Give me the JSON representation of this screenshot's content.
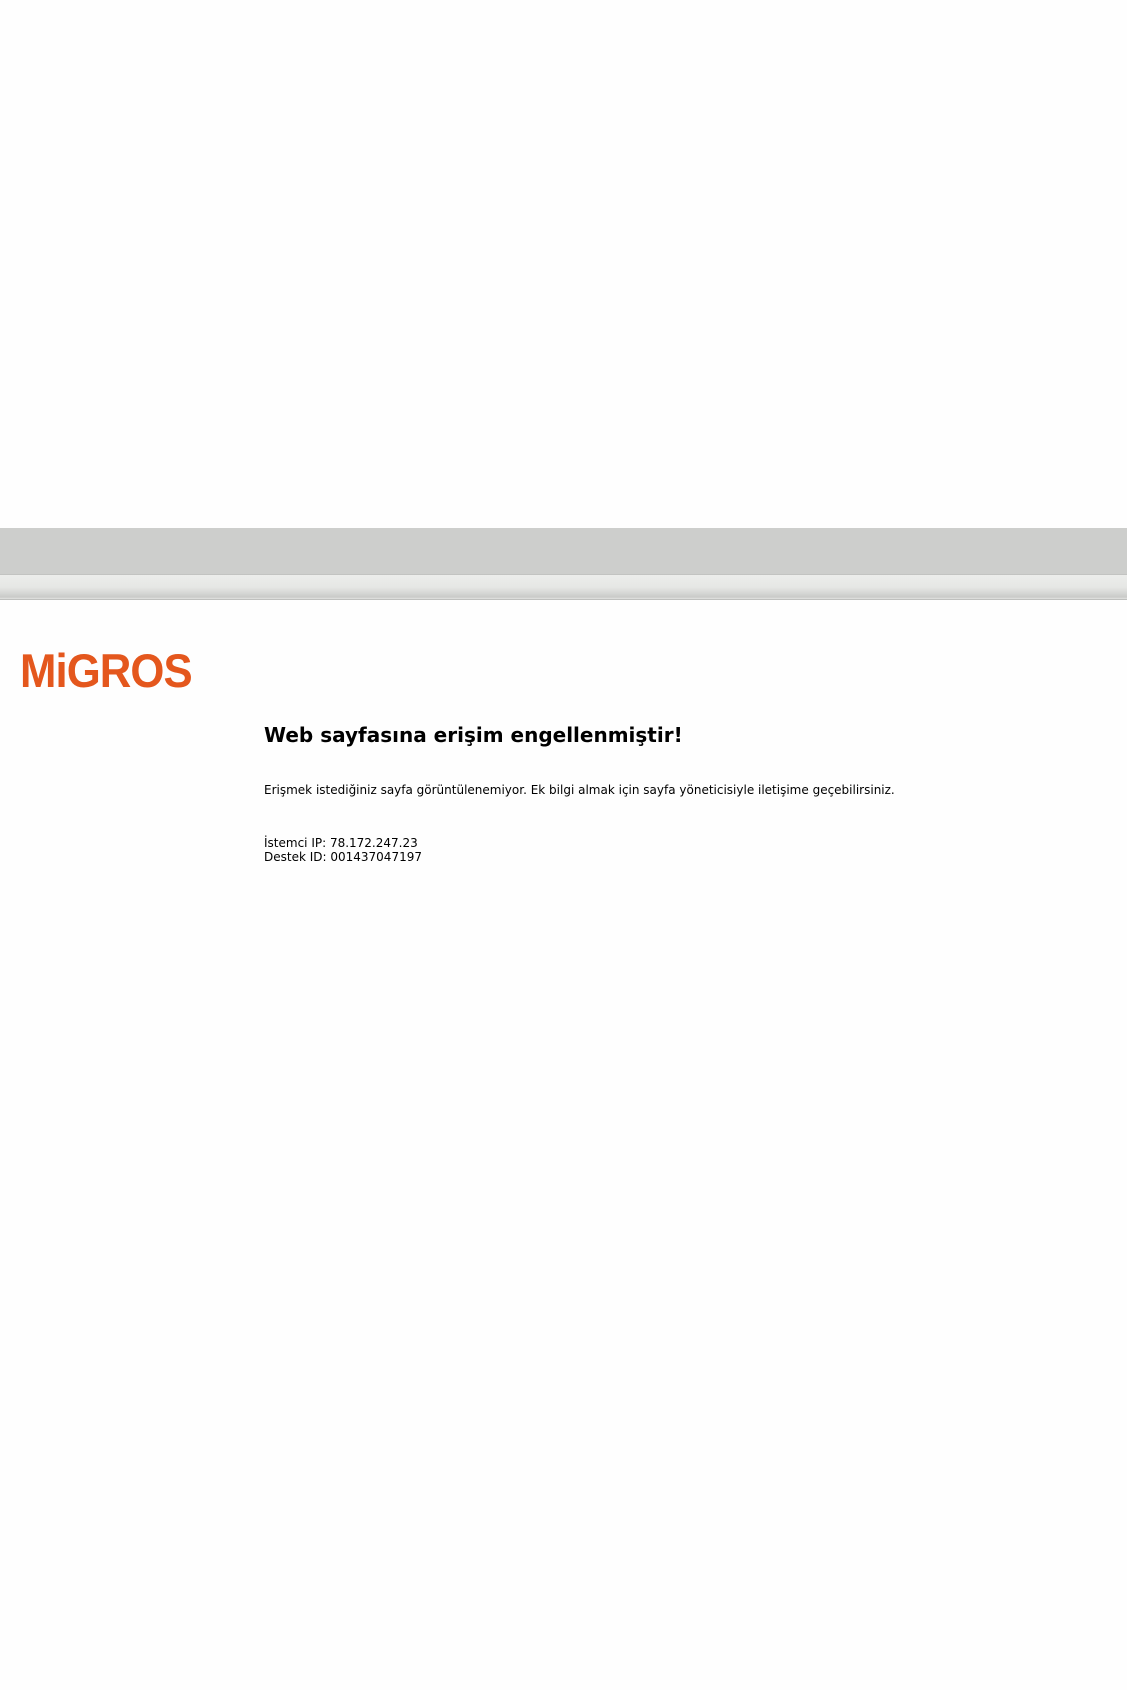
{
  "brand": {
    "logo_text": "MiGROS",
    "color": "#e4571d"
  },
  "header": {
    "bar_color": "#cdcecc"
  },
  "page": {
    "title": "Web sayfasına erişim engellenmiştir!",
    "message": "Erişmek istediğiniz sayfa görüntülenemiyor. Ek bilgi almak için sayfa yöneticisiyle iletişime geçebilirsiniz.",
    "client_ip_line": "İstemci IP: 78.172.247.23",
    "support_id_line": "Destek ID: 001437047197"
  }
}
